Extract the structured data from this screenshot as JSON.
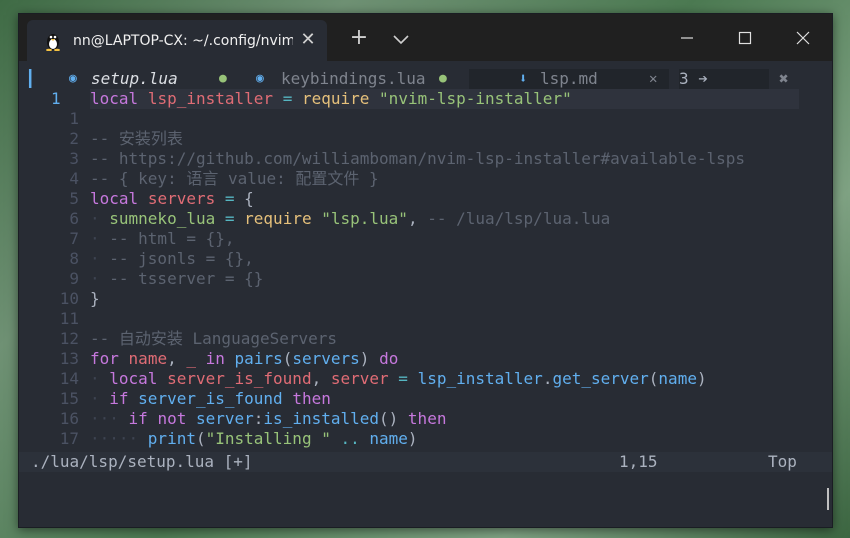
{
  "window": {
    "tab_title": "nn@LAPTOP-CX: ~/.config/nvim",
    "tab_icon": "linux-penguin-icon"
  },
  "buffers": [
    {
      "name": "setup.lua",
      "modified": "●",
      "active": true
    },
    {
      "name": "keybindings.lua",
      "modified": "●",
      "active": false
    },
    {
      "name": "lsp.md",
      "modified": "✕",
      "active": false
    }
  ],
  "buffer_count": "3",
  "close_all": "✖",
  "lines": [
    {
      "n": "1",
      "html": "<span class=\"kw\">local</span> <span class=\"var\">lsp_installer</span> <span class=\"op\">=</span> <span class=\"yl\">require</span> <span class=\"str\">\"nvim-lsp-installer\"</span>"
    },
    {
      "n": "1",
      "html": ""
    },
    {
      "n": "2",
      "html": "<span class=\"cm\">-- 安装列表</span>"
    },
    {
      "n": "3",
      "html": "<span class=\"cm\">-- https://github.com/williamboman/nvim-lsp-installer#available-lsps</span>"
    },
    {
      "n": "4",
      "html": "<span class=\"cm\">-- { key: 语言 value: 配置文件 }</span>"
    },
    {
      "n": "5",
      "html": "<span class=\"kw\">local</span> <span class=\"var\">servers</span> <span class=\"op\">=</span> <span class=\"br\">{</span>"
    },
    {
      "n": "6",
      "html": "<span class=\"ws\">· </span><span class=\"str\">sumneko_lua</span> <span class=\"op\">=</span> <span class=\"yl\">require</span> <span class=\"str\">\"lsp.lua\"</span><span class=\"br\">,</span> <span class=\"cm\">-- /lua/lsp/lua.lua</span>"
    },
    {
      "n": "7",
      "html": "<span class=\"ws\">· </span><span class=\"cm\">-- html = {},</span>"
    },
    {
      "n": "8",
      "html": "<span class=\"ws\">· </span><span class=\"cm\">-- jsonls = {},</span>"
    },
    {
      "n": "9",
      "html": "<span class=\"ws\">· </span><span class=\"cm\">-- tsserver = {}</span>"
    },
    {
      "n": "10",
      "html": "<span class=\"br\">}</span>"
    },
    {
      "n": "11",
      "html": ""
    },
    {
      "n": "12",
      "html": "<span class=\"cm\">-- 自动安装 LanguageServers</span>"
    },
    {
      "n": "13",
      "html": "<span class=\"kw\">for</span> <span class=\"var\">name</span><span class=\"br\">,</span> <span class=\"var\">_</span> <span class=\"kw\">in</span> <span class=\"fn\">pairs</span><span class=\"br\">(</span><span class=\"id\">servers</span><span class=\"br\">)</span> <span class=\"kw\">do</span>"
    },
    {
      "n": "14",
      "html": "<span class=\"ws\">· </span><span class=\"kw\">local</span> <span class=\"var\">server_is_found</span><span class=\"br\">,</span> <span class=\"var\">server</span> <span class=\"op\">=</span> <span class=\"id\">lsp_installer</span><span class=\"br\">.</span><span class=\"fn\">get_server</span><span class=\"br\">(</span><span class=\"id\">name</span><span class=\"br\">)</span>"
    },
    {
      "n": "15",
      "html": "<span class=\"ws\">· </span><span class=\"kw\">if</span> <span class=\"id\">server_is_found</span> <span class=\"kw\">then</span>"
    },
    {
      "n": "16",
      "html": "<span class=\"ws\">··· </span><span class=\"kw\">if</span> <span class=\"kw\">not</span> <span class=\"id\">server</span><span class=\"br\">:</span><span class=\"fn\">is_installed</span><span class=\"br\">()</span> <span class=\"kw\">then</span>"
    },
    {
      "n": "17",
      "html": "<span class=\"ws\">····· </span><span class=\"fn\">print</span><span class=\"br\">(</span><span class=\"str\">\"Installing \"</span> <span class=\"op\">..</span> <span class=\"id\">name</span><span class=\"br\">)</span>"
    }
  ],
  "status": {
    "path": "./lua/lsp/setup.lua [+]",
    "position": "1,15",
    "scroll": "Top"
  },
  "colors": {
    "bg": "#282c34",
    "keyword": "#c678dd",
    "string": "#98c379",
    "comment": "#5c6370",
    "function": "#61afef"
  }
}
